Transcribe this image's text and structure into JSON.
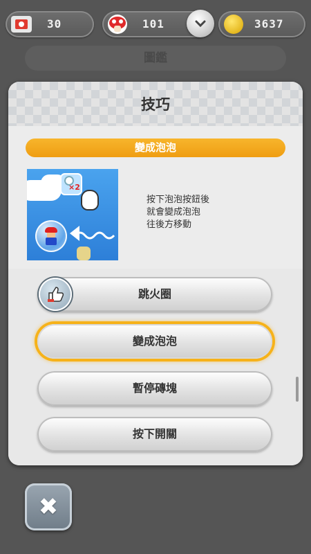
{
  "status_bar": {
    "tickets": "30",
    "toad_rally_tickets": "101",
    "coins": "3637"
  },
  "background": {
    "label": "圖鑑"
  },
  "dialog": {
    "title": "技巧",
    "move_name": "變成泡泡",
    "preview": {
      "multiplier": "×2"
    },
    "description": "按下泡泡按鈕後\n就會變成泡泡\n往後方移動",
    "list": [
      {
        "label": "跳火圈",
        "has_icon": true,
        "selected": false
      },
      {
        "label": "變成泡泡",
        "has_icon": false,
        "selected": true
      },
      {
        "label": "暫停磚塊",
        "has_icon": false,
        "selected": false
      },
      {
        "label": "按下開關",
        "has_icon": false,
        "selected": false
      }
    ]
  },
  "icons": {
    "ticket": "ticket-icon",
    "toad": "toad-icon",
    "coin": "coin-icon",
    "dropdown": "chevron-down-icon",
    "thumbs_up": "thumbs-up-icon",
    "close": "close-icon"
  },
  "colors": {
    "accent_orange": "#f2a516",
    "selection_glow": "#f6b21a"
  }
}
